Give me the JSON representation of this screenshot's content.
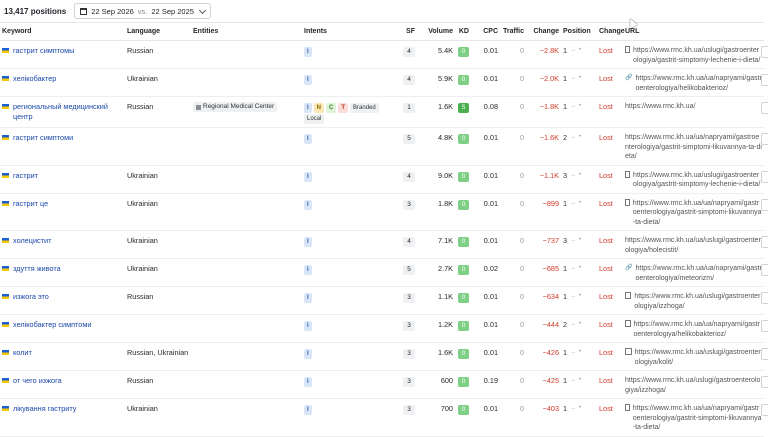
{
  "header": {
    "positions_count": "13,417 positions",
    "date_current": "22 Sep 2026",
    "vs_label": "vs.",
    "date_compare": "22 Sep 2025"
  },
  "columns": {
    "keyword": "Keyword",
    "language": "Language",
    "entities": "Entities",
    "intents": "Intents",
    "sf": "SF",
    "volume": "Volume",
    "kd": "KD",
    "cpc": "CPC",
    "traffic": "Traffic",
    "change": "Change",
    "position": "Position",
    "pos_change": "Change",
    "url": "URL"
  },
  "rows": [
    {
      "keyword": "гастрит симптомы",
      "language": "Russian",
      "entity": "",
      "intents": [
        "I"
      ],
      "tags": [],
      "sf": "4",
      "volume": "5.4K",
      "kd": "0",
      "cpc": "0.01",
      "traffic": "0",
      "change": "−2.8K",
      "position": "1",
      "pos_arrow": "→",
      "pos_end": "•",
      "status": "Lost",
      "url_icon": "image",
      "url": "https://www.rmc.kh.ua/uslugi/gastroenterologiya/gastrit-simptomy-lechenie-i-dieta/"
    },
    {
      "keyword": "хелікобактер",
      "language": "Ukrainian",
      "entity": "",
      "intents": [
        "I"
      ],
      "tags": [],
      "sf": "4",
      "volume": "5.9K",
      "kd": "0",
      "cpc": "0.01",
      "traffic": "0",
      "change": "−2.0K",
      "position": "1",
      "pos_arrow": "→",
      "pos_end": "•",
      "status": "Lost",
      "url_icon": "link",
      "url": "https://www.rmc.kh.ua/ua/napryami/gastroenterologiya/helikobakterioz/"
    },
    {
      "keyword": "региональный медицинский центр",
      "language": "Russian",
      "entity": "Regional Medical Center",
      "intents": [
        "I",
        "N",
        "C",
        "T"
      ],
      "tags": [
        "Branded",
        "Local"
      ],
      "sf": "1",
      "volume": "1.6K",
      "kd": "5",
      "cpc": "0.08",
      "traffic": "0",
      "change": "−1.8K",
      "position": "1",
      "pos_arrow": "→",
      "pos_end": "•",
      "status": "Lost",
      "url_icon": "",
      "url": "https://www.rmc.kh.ua/"
    },
    {
      "keyword": "гастрит симптоми",
      "language": "",
      "entity": "",
      "intents": [
        "I"
      ],
      "tags": [],
      "sf": "5",
      "volume": "4.8K",
      "kd": "0",
      "cpc": "0.01",
      "traffic": "0",
      "change": "−1.6K",
      "position": "2",
      "pos_arrow": "→",
      "pos_end": "•",
      "status": "Lost",
      "url_icon": "",
      "url": "https://www.rmc.kh.ua/ua/napryami/gastroenterologiya/gastrit-simptomi-likuvannya-ta-dieta/"
    },
    {
      "keyword": "гастрит",
      "language": "Ukrainian",
      "entity": "",
      "intents": [
        "I"
      ],
      "tags": [],
      "sf": "4",
      "volume": "9.0K",
      "kd": "0",
      "cpc": "0.01",
      "traffic": "0",
      "change": "−1.1K",
      "position": "3",
      "pos_arrow": "→",
      "pos_end": "•",
      "status": "Lost",
      "url_icon": "image",
      "url": "https://www.rmc.kh.ua/uslugi/gastroenterologiya/gastrit-simptomy-lechenie-i-dieta/"
    },
    {
      "keyword": "гастрит це",
      "language": "Ukrainian",
      "entity": "",
      "intents": [
        "I"
      ],
      "tags": [],
      "sf": "3",
      "volume": "1.8K",
      "kd": "0",
      "cpc": "0.01",
      "traffic": "0",
      "change": "−899",
      "position": "1",
      "pos_arrow": "→",
      "pos_end": "•",
      "status": "Lost",
      "url_icon": "image",
      "url": "https://www.rmc.kh.ua/ua/napryami/gastroenterologiya/gastrit-simptomi-likuvannya-ta-dieta/"
    },
    {
      "keyword": "холецистит",
      "language": "Ukrainian",
      "entity": "",
      "intents": [
        "I"
      ],
      "tags": [],
      "sf": "4",
      "volume": "7.1K",
      "kd": "0",
      "cpc": "0.01",
      "traffic": "0",
      "change": "−737",
      "position": "3",
      "pos_arrow": "→",
      "pos_end": "•",
      "status": "Lost",
      "url_icon": "",
      "url": "https://www.rmc.kh.ua/ua/uslugi/gastroenterologiya/holecistit/"
    },
    {
      "keyword": "здуття живота",
      "language": "Ukrainian",
      "entity": "",
      "intents": [
        "I"
      ],
      "tags": [],
      "sf": "5",
      "volume": "2.7K",
      "kd": "0",
      "cpc": "0.02",
      "traffic": "0",
      "change": "−685",
      "position": "1",
      "pos_arrow": "→",
      "pos_end": "•",
      "status": "Lost",
      "url_icon": "link",
      "url": "https://www.rmc.kh.ua/ua/napryami/gastroenterologiya/meteorizm/"
    },
    {
      "keyword": "изжога это",
      "language": "Russian",
      "entity": "",
      "intents": [
        "I"
      ],
      "tags": [],
      "sf": "3",
      "volume": "1.1K",
      "kd": "0",
      "cpc": "0.01",
      "traffic": "0",
      "change": "−634",
      "position": "1",
      "pos_arrow": "→",
      "pos_end": "•",
      "status": "Lost",
      "url_icon": "image",
      "url": "https://www.rmc.kh.ua/uslugi/gastroenterologiya/izzhoga/"
    },
    {
      "keyword": "хелікобактер симптоми",
      "language": "",
      "entity": "",
      "intents": [
        "I"
      ],
      "tags": [],
      "sf": "3",
      "volume": "1.2K",
      "kd": "0",
      "cpc": "0.01",
      "traffic": "0",
      "change": "−444",
      "position": "2",
      "pos_arrow": "→",
      "pos_end": "•",
      "status": "Lost",
      "url_icon": "image",
      "url": "https://www.rmc.kh.ua/ua/napryami/gastroenterologiya/helikobakterioz/"
    },
    {
      "keyword": "колит",
      "language": "Russian, Ukrainian",
      "entity": "",
      "intents": [
        "I"
      ],
      "tags": [],
      "sf": "3",
      "volume": "1.6K",
      "kd": "0",
      "cpc": "0.01",
      "traffic": "0",
      "change": "−426",
      "position": "1",
      "pos_arrow": "→",
      "pos_end": "•",
      "status": "Lost",
      "url_icon": "image",
      "url": "https://www.rmc.kh.ua/uslugi/gastroenterologiya/kolit/"
    },
    {
      "keyword": "от чего изжога",
      "language": "Russian",
      "entity": "",
      "intents": [
        "I"
      ],
      "tags": [],
      "sf": "3",
      "volume": "600",
      "kd": "0",
      "cpc": "0.19",
      "traffic": "0",
      "change": "−425",
      "position": "1",
      "pos_arrow": "→",
      "pos_end": "•",
      "status": "Lost",
      "url_icon": "",
      "url": "https://www.rmc.kh.ua/uslugi/gastroenterologiya/izzhoga/"
    },
    {
      "keyword": "лікування гастриту",
      "language": "Ukrainian",
      "entity": "",
      "intents": [
        "I"
      ],
      "tags": [],
      "sf": "3",
      "volume": "700",
      "kd": "0",
      "cpc": "0.01",
      "traffic": "0",
      "change": "−403",
      "position": "1",
      "pos_arrow": "→",
      "pos_end": "•",
      "status": "Lost",
      "url_icon": "image",
      "url": "https://www.rmc.kh.ua/ua/napryami/gastroenterologiya/gastrit-simptomi-likuvannya-ta-dieta/"
    }
  ]
}
